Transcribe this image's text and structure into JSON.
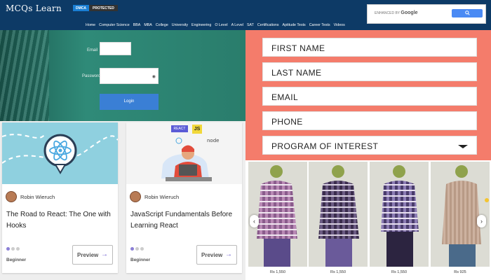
{
  "header": {
    "logo": "MCQs Learn",
    "badge_left": "DMCA",
    "badge_right": "PROTECTED",
    "search_enhanced": "ENHANCED BY",
    "search_brand": "Google",
    "nav": [
      "Home",
      "Computer Science",
      "BBA",
      "MBA",
      "College",
      "University",
      "Engineering",
      "O Level",
      "A Level",
      "SAT",
      "Certifications",
      "Aptitude Tests",
      "Career Tests",
      "Videos"
    ]
  },
  "login": {
    "email_label": "Email",
    "password_label": "Password",
    "login_button": "Login"
  },
  "form": {
    "fields": [
      "FIRST NAME",
      "LAST NAME",
      "EMAIL",
      "PHONE"
    ],
    "program": "PROGRAM OF INTEREST"
  },
  "courses": [
    {
      "author": "Robin Wieruch",
      "title": "The Road to React: The One with Hooks",
      "level": "Beginner",
      "action": "Preview"
    },
    {
      "author": "Robin Wieruch",
      "title": "JavaScript Fundamentals Before Learning React",
      "level": "Beginner",
      "action": "Preview",
      "tags": [
        "REACT",
        "JS",
        "node"
      ]
    }
  ],
  "shirts": {
    "prices": [
      "Rs 1,550",
      "Rs 1,550",
      "Rs 1,550",
      "Rs 925"
    ],
    "prev_icon": "chevron-left-icon",
    "next_icon": "chevron-right-icon"
  },
  "colors": {
    "header_bg": "#0d3a66",
    "form_bg": "#f47c6b",
    "login_button": "#3a7fd5",
    "accent": "#6a5acd"
  }
}
